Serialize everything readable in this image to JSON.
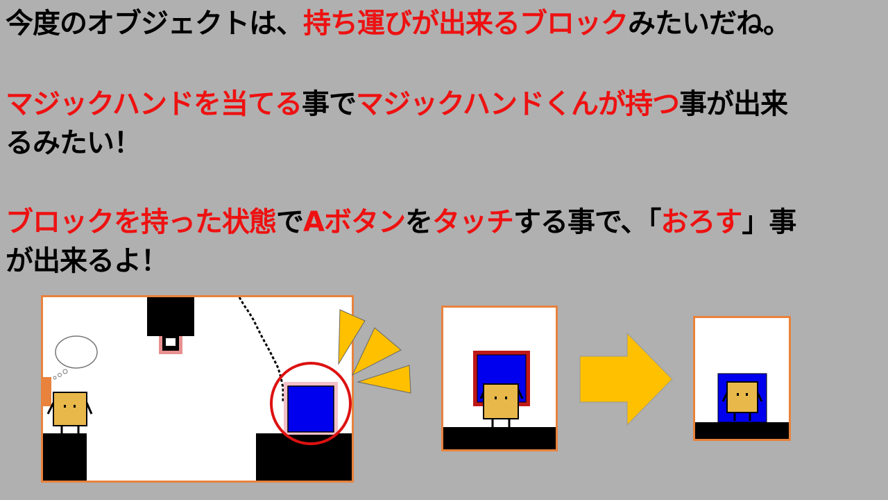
{
  "instructions": {
    "line1": [
      {
        "text": "今度のオブジェクトは、",
        "color": "black"
      },
      {
        "text": "持ち運びが出来るブロック",
        "color": "red"
      },
      {
        "text": "みたいだね。",
        "color": "black"
      }
    ],
    "line2": [
      {
        "text": "マジックハンドを当てる",
        "color": "red"
      },
      {
        "text": "事で",
        "color": "black"
      },
      {
        "text": "マジックハンドくんが持つ",
        "color": "red"
      },
      {
        "text": "事が出来",
        "color": "black"
      }
    ],
    "line3": [
      {
        "text": "るみたい！",
        "color": "black"
      }
    ],
    "line4": [
      {
        "text": "ブロックを持った状態",
        "color": "red"
      },
      {
        "text": "で",
        "color": "black"
      },
      {
        "text": "Aボタン",
        "color": "red"
      },
      {
        "text": "を",
        "color": "black"
      },
      {
        "text": "タッチ",
        "color": "red"
      },
      {
        "text": "する事で、「",
        "color": "black"
      },
      {
        "text": "おろす",
        "color": "red"
      },
      {
        "text": "」事",
        "color": "black"
      }
    ],
    "line5": [
      {
        "text": "が出来るよ！",
        "color": "black"
      }
    ]
  },
  "colors": {
    "background": "#b0b0b0",
    "red_text": "#ee1111",
    "panel_border": "#e8823c",
    "block_blue": "#0000ee",
    "character": "#e8b84a",
    "arrow": "#ffc000",
    "highlight_circle": "#dd1111"
  },
  "illustrations": {
    "scene": "magic-hand-touching-blue-block",
    "before": "character-holding-blue-block",
    "after": "character-carrying-blue-block",
    "arrow_icon": "right-arrow-icon"
  }
}
